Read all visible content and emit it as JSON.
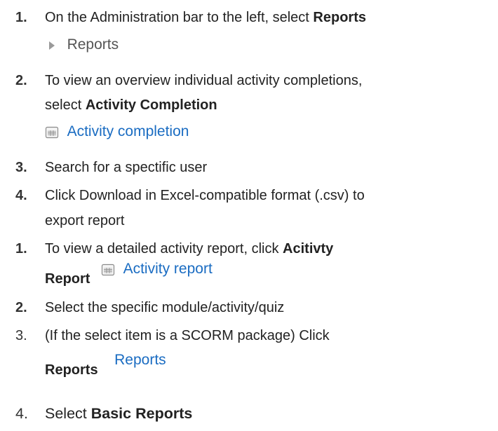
{
  "steps": [
    {
      "num": "1.",
      "pre": "On the Administration bar to the left, select ",
      "bold": "Reports"
    },
    {
      "screenshot": "Reports",
      "icon": "triangle-right-icon"
    },
    {
      "num": "2.",
      "pre": "To view an overview individual activity completions,"
    },
    {
      "pre": "select ",
      "bold": "Activity Completion"
    },
    {
      "screenshot": "Activity completion",
      "icon": "spreadsheet-icon"
    },
    {
      "num": "3.",
      "pre": "Search for a spectific user"
    },
    {
      "num": "4.",
      "pre": "Click Download in Excel-compatible format (.csv) to"
    },
    {
      "pre": "export report"
    },
    {
      "num": "1.",
      "pre": "To view a detailed activity report, click ",
      "bold": "Acitivty"
    },
    {
      "bold": "Report",
      "screenshot": "Activity report",
      "icon": "spreadsheet-icon"
    },
    {
      "num": "2.",
      "pre": "Select the specific module/activity/quiz"
    },
    {
      "num": "3.",
      "pre": "(If the select item is a SCORM package) Click"
    },
    {
      "bold": "Reports",
      "screenshot": "Reports"
    },
    {
      "num": "4.",
      "pre": "Select ",
      "bold": "Basic Reports"
    }
  ],
  "colors": {
    "link_blue": "#1a6cc2",
    "text": "#222222",
    "gray": "#555555"
  }
}
